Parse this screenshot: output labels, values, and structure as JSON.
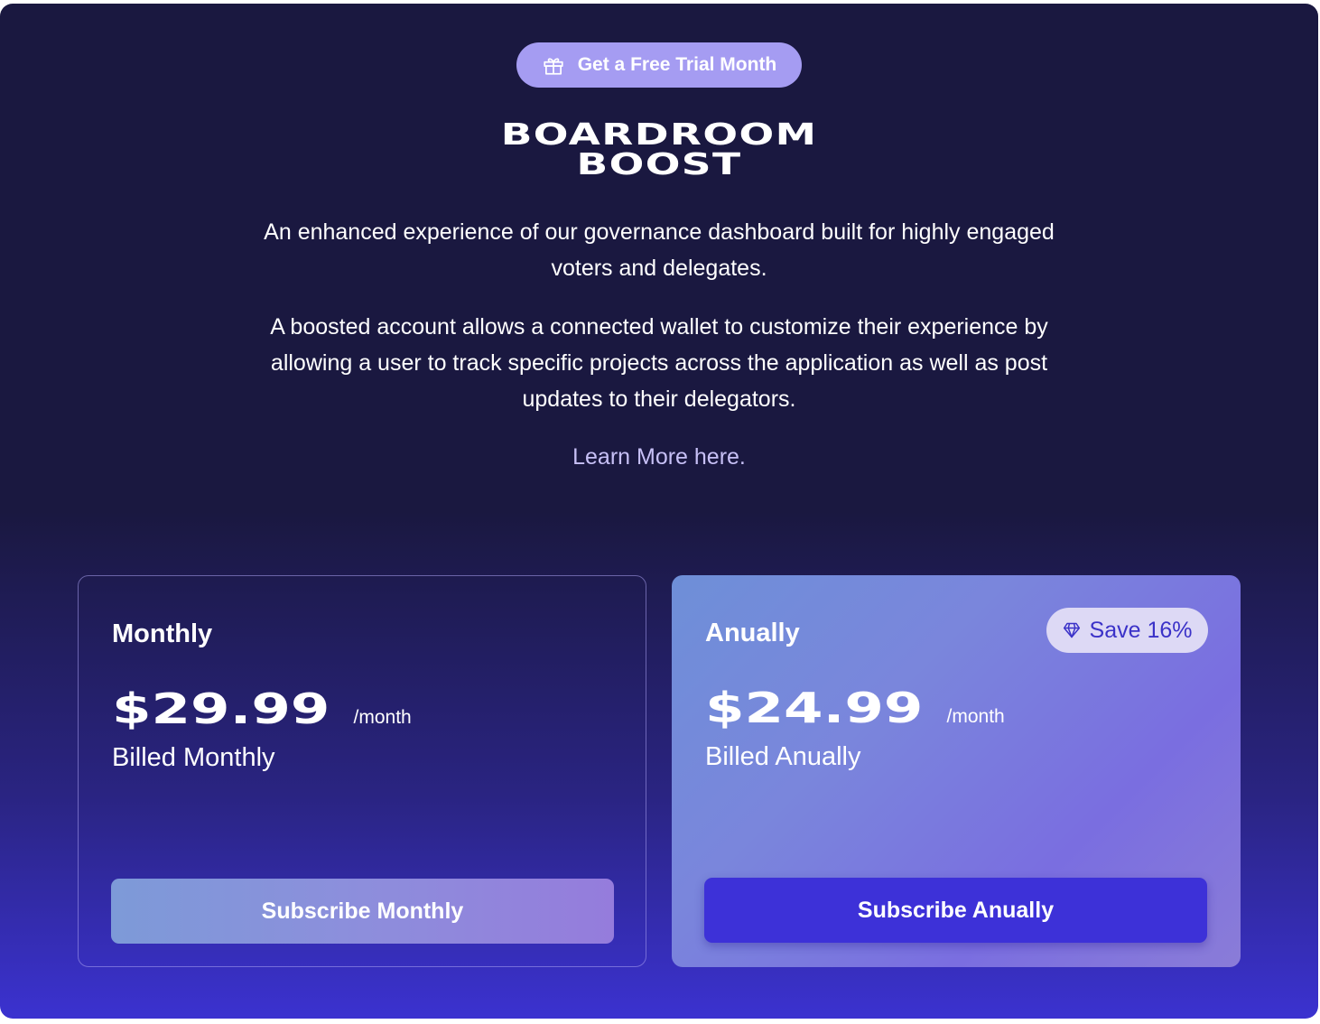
{
  "trial": {
    "label": "Get a Free Trial Month",
    "icon": "gift-icon"
  },
  "brand": {
    "line1": "BOARDROOM",
    "line2": "BOOST"
  },
  "description": {
    "p1": "An enhanced experience of our governance dashboard built for highly engaged voters and delegates.",
    "p2": "A boosted account allows a connected wallet to customize their experience by allowing a user to track specific projects across the application as well as post updates to their delegators.",
    "learn_more": "Learn More here."
  },
  "plans": {
    "monthly": {
      "title": "Monthly",
      "price": "$29.99",
      "per": "/month",
      "billed": "Billed Monthly",
      "button": "Subscribe Monthly"
    },
    "annual": {
      "title": "Anually",
      "price": "$24.99",
      "per": "/month",
      "billed": "Billed Anually",
      "button": "Subscribe Anually",
      "badge": "Save 16%",
      "badge_icon": "gem-icon"
    }
  },
  "colors": {
    "background_top": "#1a1840",
    "background_bottom": "#3b32d0",
    "trial_pill": "#a59cf2",
    "annual_button": "#3d31d8",
    "badge_text": "#3b32c8",
    "link": "#c7c0f6"
  }
}
